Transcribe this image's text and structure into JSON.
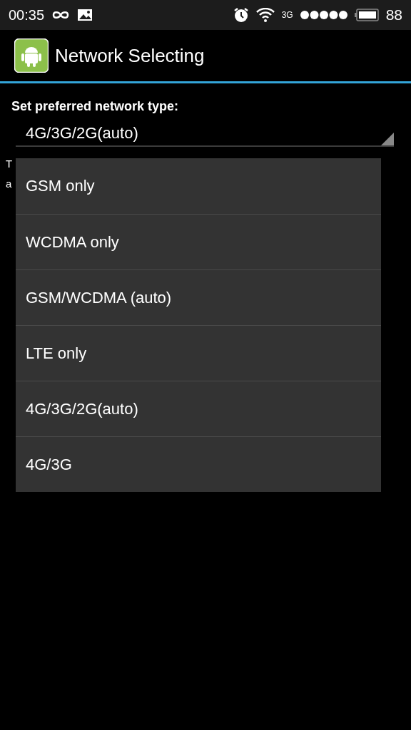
{
  "status_bar": {
    "time": "00:35",
    "network": "3G",
    "battery": "88"
  },
  "action_bar": {
    "title": "Network Selecting"
  },
  "setting": {
    "label": "Set preferred network type:",
    "value": "4G/3G/2G(auto)"
  },
  "hidden_text": [
    "T",
    "a"
  ],
  "dropdown": {
    "options": [
      {
        "label": "GSM only"
      },
      {
        "label": "WCDMA only"
      },
      {
        "label": "GSM/WCDMA (auto)"
      },
      {
        "label": "LTE only"
      },
      {
        "label": "4G/3G/2G(auto)"
      },
      {
        "label": "4G/3G"
      }
    ]
  }
}
